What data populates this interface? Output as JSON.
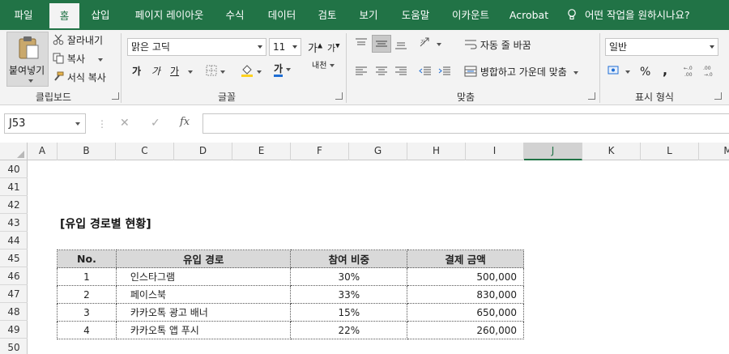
{
  "tabs": [
    "파일",
    "홈",
    "삽입",
    "페이지 레이아웃",
    "수식",
    "데이터",
    "검토",
    "보기",
    "도움말",
    "이카운트",
    "Acrobat"
  ],
  "tell_me": "어떤 작업을 원하시나요?",
  "ribbon": {
    "clipboard": {
      "paste": "붙여넣기",
      "cut": "잘라내기",
      "copy": "복사",
      "format_painter": "서식 복사",
      "label": "클립보드"
    },
    "font": {
      "name": "맑은 고딕",
      "size": "11",
      "grow": "가",
      "shrink": "가",
      "bold": "가",
      "italic": "가",
      "underline": "가",
      "font_color_glyph": "가",
      "phonetic": "내천",
      "label": "글꼴"
    },
    "alignment": {
      "wrap_text": "자동 줄 바꿈",
      "merge_center": "병합하고 가운데 맞춤",
      "label": "맞춤"
    },
    "number": {
      "format": "일반",
      "percent": "%",
      "comma": ",",
      "label": "표시 형식"
    }
  },
  "formula_bar": {
    "name_box": "J53",
    "cancel": "✕",
    "enter": "✓",
    "fx": "fx",
    "value": ""
  },
  "columns": [
    "A",
    "B",
    "C",
    "D",
    "E",
    "F",
    "G",
    "H",
    "I",
    "J",
    "K",
    "L",
    "M"
  ],
  "selected_column": "J",
  "rows": [
    "40",
    "41",
    "42",
    "43",
    "44",
    "45",
    "46",
    "47",
    "48",
    "49",
    "50"
  ],
  "sheet": {
    "title": "[유입 경로별 현황]",
    "headers": [
      "No.",
      "유입 경로",
      "참여 비중",
      "결제 금액"
    ],
    "data": [
      [
        "1",
        "인스타그램",
        "30%",
        "500,000"
      ],
      [
        "2",
        "페이스북",
        "33%",
        "830,000"
      ],
      [
        "3",
        "카카오톡 광고 배너",
        "15%",
        "650,000"
      ],
      [
        "4",
        "카카오톡 앱 푸시",
        "22%",
        "260,000"
      ]
    ]
  },
  "colors": {
    "accent": "#217346",
    "ribbon_bg": "#f3f3f3",
    "header_fill": "#d9d9d9"
  }
}
